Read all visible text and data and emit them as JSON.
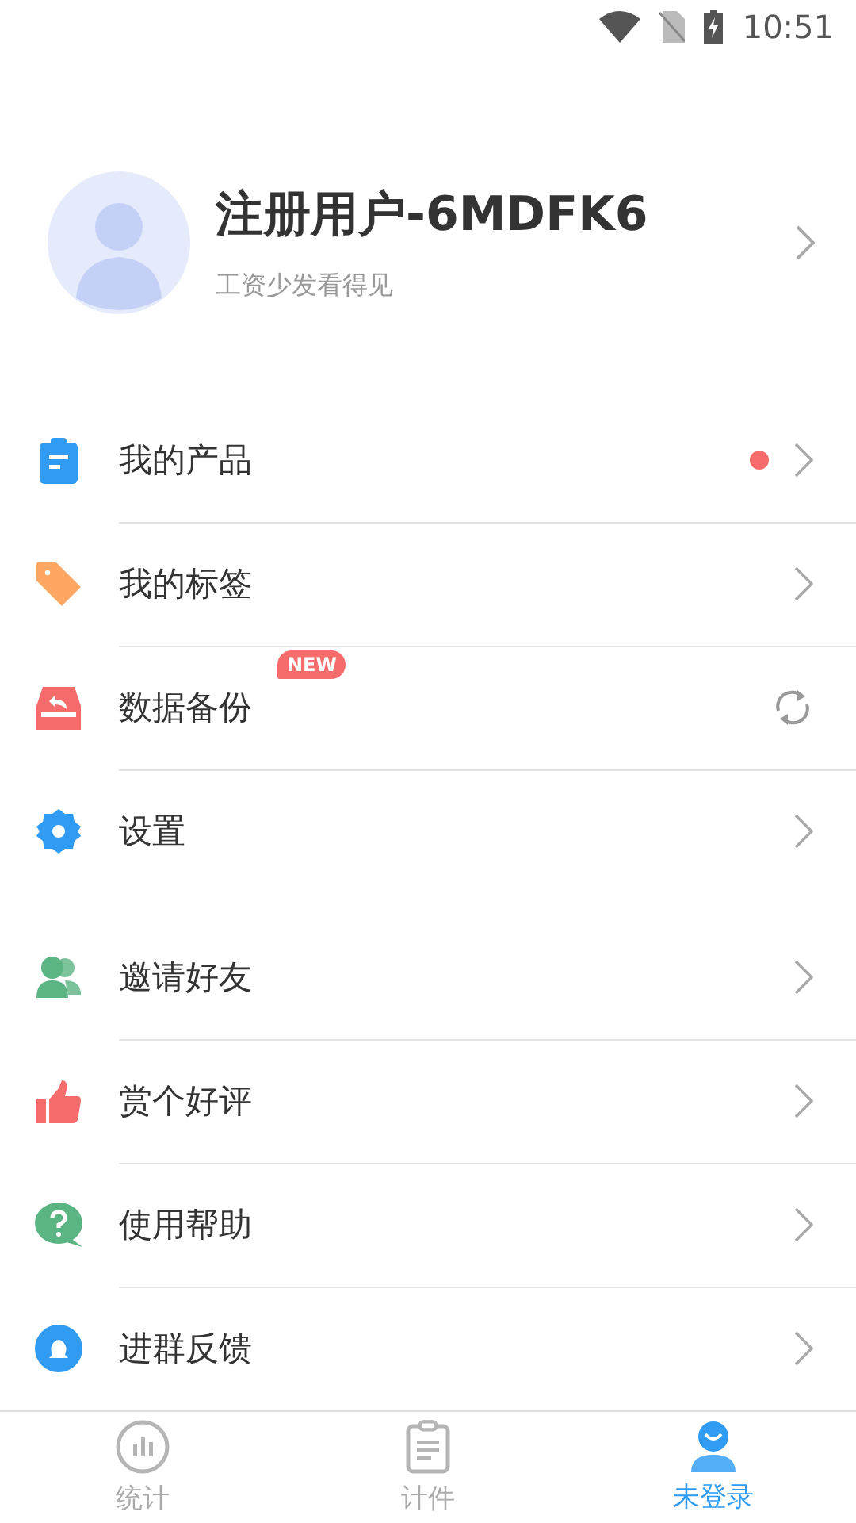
{
  "status_bar": {
    "time": "10:51"
  },
  "profile": {
    "name": "注册用户-6MDFK6",
    "subtitle": "工资少发看得见"
  },
  "menu_groups": [
    {
      "items": [
        {
          "label": "我的产品",
          "kind": "link",
          "dot": true
        },
        {
          "label": "我的标签",
          "kind": "link",
          "dot": false
        },
        {
          "label": "数据备份",
          "kind": "sync",
          "dot": false,
          "badge": "NEW"
        },
        {
          "label": "设置",
          "kind": "link",
          "dot": false
        }
      ]
    },
    {
      "items": [
        {
          "label": "邀请好友",
          "kind": "link",
          "dot": false
        },
        {
          "label": "赏个好评",
          "kind": "link",
          "dot": false
        },
        {
          "label": "使用帮助",
          "kind": "link",
          "dot": false
        },
        {
          "label": "进群反馈",
          "kind": "link",
          "dot": false
        }
      ]
    }
  ],
  "tabs": [
    {
      "label": "统计",
      "selected": false
    },
    {
      "label": "计件",
      "selected": false
    },
    {
      "label": "未登录",
      "selected": true
    }
  ]
}
